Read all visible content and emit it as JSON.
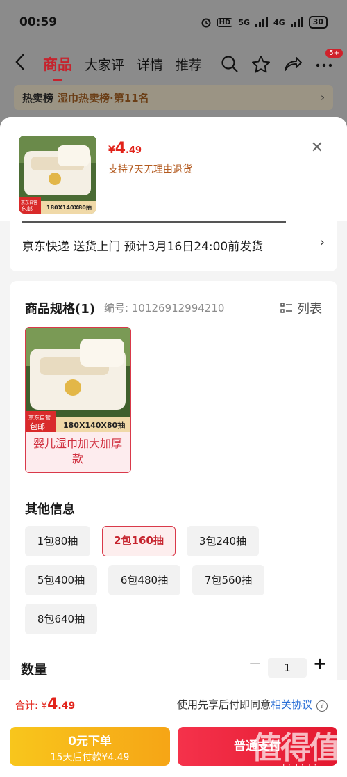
{
  "status_bar": {
    "time": "00:59",
    "hd": "HD",
    "net1": "5G",
    "net2": "4G",
    "battery": "30"
  },
  "nav": {
    "tabs": [
      "商品",
      "大家评",
      "详情",
      "推荐"
    ],
    "badge": "5+"
  },
  "hot": {
    "label": "热卖榜",
    "text": "湿巾热卖榜·第11名"
  },
  "product": {
    "price_yen": "¥",
    "price_int": "4",
    "price_dec": ".49",
    "return_note": "支持7天无理由退货",
    "thumb_tag": "京东自营",
    "thumb_ship": "包邮",
    "thumb_size": "180X140X80抽"
  },
  "delivery": {
    "text": "京东快递 送货上门 预计3月16日24:00前发货"
  },
  "spec": {
    "title": "商品规格(1)",
    "code": "编号: 10126912994210",
    "list_label": "列表",
    "variant_name": "婴儿湿巾加大加厚款",
    "variant_tag": "京东自营",
    "variant_ship": "包邮",
    "variant_size": "180X140X80抽"
  },
  "other": {
    "title": "其他信息",
    "options": [
      "1包80抽",
      "2包160抽",
      "3包240抽",
      "5包400抽",
      "6包480抽",
      "7包560抽",
      "8包640抽"
    ],
    "selected": "2包160抽"
  },
  "quantity": {
    "label": "数量",
    "value": "1",
    "minus": "−",
    "plus": "+"
  },
  "footer": {
    "total_label": "合计: ",
    "total_yen": "¥",
    "total_int": "4",
    "total_dec": ".49",
    "agree_text": "使用先享后付即同意",
    "agree_link": "相关协议",
    "btn_left_line1": "0元下单",
    "btn_left_line2": "15天后付款¥4.49",
    "btn_right": "普通支付"
  },
  "watermark": {
    "big": "值得值",
    "url": "zhizhizhi.com"
  },
  "colors": {
    "accent": "#e2231a",
    "selected_border": "#d9394a",
    "pay_later": "#f6a516"
  }
}
